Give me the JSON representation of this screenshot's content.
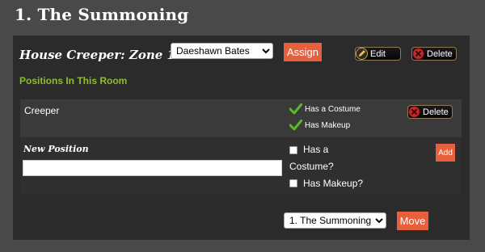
{
  "page": {
    "title": "1. The Summoning"
  },
  "zone": {
    "title": "House Creeper: Zone 1",
    "assignee": {
      "selected": "Daeshawn Bates"
    },
    "assign_label": "Assign",
    "edit_label": "Edit",
    "delete_label": "Delete"
  },
  "positions": {
    "header": "Positions In This Room",
    "items": [
      {
        "name": "Creeper",
        "costume_label": "Has a Costume",
        "makeup_label": "Has Makeup",
        "delete_label": "Delete"
      }
    ]
  },
  "new_position": {
    "label": "New Position",
    "value": "",
    "costume_label": "Has a Costume?",
    "makeup_label": "Has Makeup?",
    "add_label": "Add"
  },
  "move": {
    "selected": "1. The Summoning",
    "button_label": "Move"
  },
  "colors": {
    "accent": "#e8603b",
    "positions_header": "#8dbf2c",
    "check": "#5cb82a",
    "delete_icon": "#c0282d"
  },
  "icons": {
    "edit": "pencil-icon",
    "delete": "delete-x-icon",
    "check": "check-icon"
  }
}
